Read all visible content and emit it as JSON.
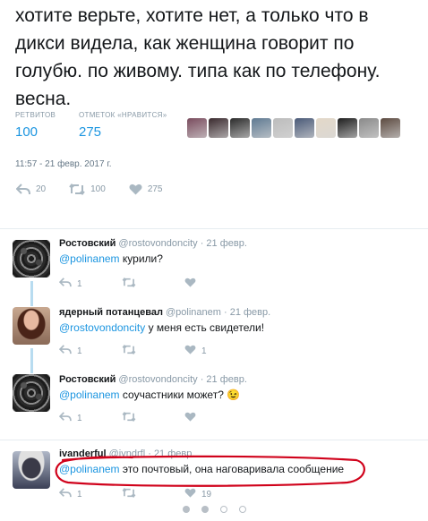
{
  "tweet": {
    "text": "хотите верьте, хотите нет, а только что в дикси видела, как женщина говорит по голубю. по живому. типа как по телефону. весна.",
    "retweets_label": "РЕТВИТОВ",
    "retweets_count": "100",
    "likes_label": "ОТМЕТОК «НРАВИТСЯ»",
    "likes_count": "275",
    "timestamp": "11:57 - 21 февр. 2017 г.",
    "actions": {
      "replies": "20",
      "retweets": "100",
      "likes": "275"
    },
    "liker_avatars": [
      "#7a4c5e",
      "#3a2a2e",
      "#2b2b2b",
      "#5f7a92",
      "#bcbcbc",
      "#4a5a78",
      "#e3d8c8",
      "#1e1e1e",
      "#8a8a8a",
      "#5c4a40"
    ]
  },
  "replies": [
    {
      "name": "Ростовский",
      "handle": "@rostovondoncity",
      "date": "· 21 февр.",
      "mention": "@polinanem",
      "text": " курили?",
      "reply_count": "1",
      "retweet_count": "",
      "like_count": ""
    },
    {
      "name": "ядерный потанцевал",
      "handle": "@polinanem",
      "date": "· 21 февр.",
      "mention": "@rostovondoncity",
      "text": " у меня есть свидетели!",
      "reply_count": "1",
      "retweet_count": "",
      "like_count": "1"
    },
    {
      "name": "Ростовский",
      "handle": "@rostovondoncity",
      "date": "· 21 февр.",
      "mention": "@polinanem",
      "text": " соучастники может? 😉",
      "reply_count": "1",
      "retweet_count": "",
      "like_count": ""
    },
    {
      "name": "ivanderful",
      "handle": "@ivndrfl",
      "date": "· 21 февр.",
      "mention": "@polinanem",
      "text": " это почтовый, она наговаривала сообщение",
      "reply_count": "1",
      "retweet_count": "",
      "like_count": "19"
    }
  ],
  "colors": {
    "accent": "#1b95e0",
    "muted": "#8899a6",
    "annotation": "#d0021b"
  }
}
